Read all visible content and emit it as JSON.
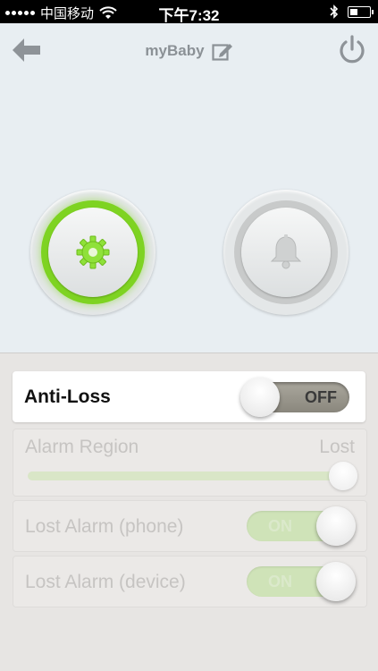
{
  "status_bar": {
    "carrier": "中国移动",
    "time": "下午7:32"
  },
  "header": {
    "title": "myBaby"
  },
  "controls": {
    "settings_icon": "gear-icon",
    "alarm_icon": "bell-icon"
  },
  "anti_loss": {
    "label": "Anti-Loss",
    "toggle_text": "OFF",
    "state": "off"
  },
  "alarm_region": {
    "label": "Alarm Region",
    "value": "Lost"
  },
  "lost_alarm_phone": {
    "label": "Lost Alarm (phone)",
    "toggle_text": "ON",
    "state": "on"
  },
  "lost_alarm_device": {
    "label": "Lost Alarm (device)",
    "toggle_text": "ON",
    "state": "on"
  },
  "colors": {
    "accent_green": "#7ed322",
    "toggle_off": "#8a877d",
    "toggle_on": "#cfe3b8",
    "disabled_text": "#c6c4c2"
  }
}
